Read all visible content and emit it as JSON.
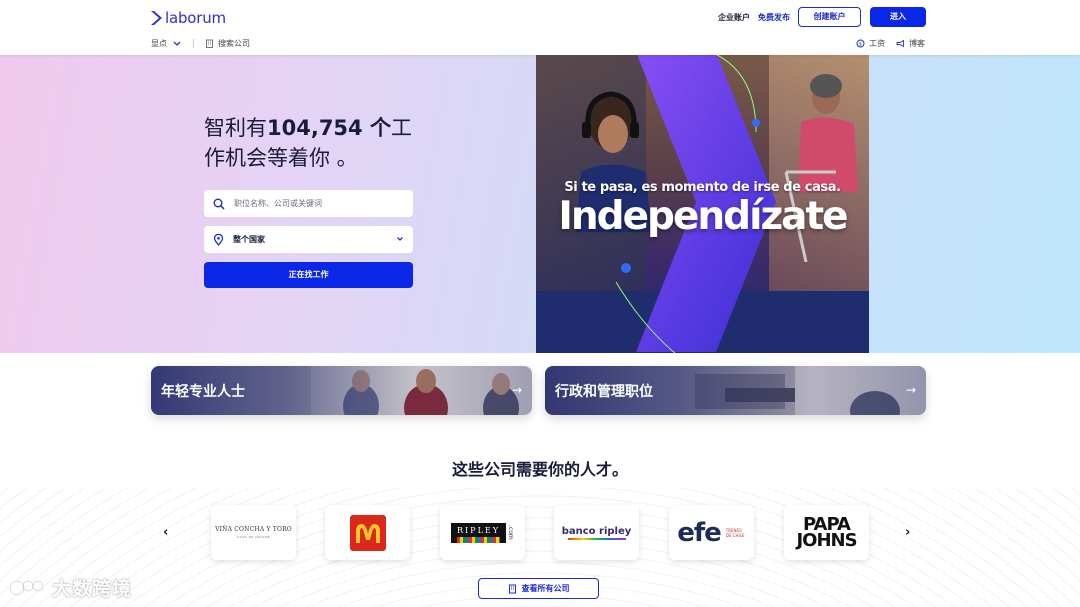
{
  "header": {
    "logo_text": "laborum",
    "enterprise_label": "企业账户",
    "free_post_label": "免费发布",
    "create_account_label": "创建账户",
    "login_label": "进入",
    "subnav_highlights": "显点",
    "subnav_search_companies": "搜索公司",
    "subnav_salary": "工资",
    "subnav_blog": "博客"
  },
  "hero": {
    "title_prefix": "智利有",
    "title_count": "104,754 个",
    "title_suffix": "工作机会等着你 。",
    "search_placeholder": "职位名称、公司或关键词",
    "location_value": "整个国家",
    "search_button": "正在找工作",
    "banner_subtitle": "Si te pasa, es momento de irse de casa.",
    "banner_title": "Independízate"
  },
  "categories": [
    {
      "label": "年轻专业人士"
    },
    {
      "label": "行政和管理职位"
    }
  ],
  "companies": {
    "title": "这些公司需要你的人才。",
    "logos": [
      {
        "line1": "VIÑA CONCHA Y TORO",
        "line2": "CASA DE ORIGEN"
      },
      {
        "mark": "M"
      },
      {
        "text": "RIPLEY",
        "suffix": ".com"
      },
      {
        "text": "banco ripley"
      },
      {
        "text": "efe",
        "side": "TRENES DE CHILE"
      },
      {
        "line1": "PAPA",
        "line2": "JOHNS"
      }
    ],
    "view_all_label": "查看所有公司"
  },
  "watermark": {
    "text": "大数跨境"
  },
  "colors": {
    "primary": "#0a26e6",
    "brand": "#2f2fc8",
    "text_dark": "#1b1c3a"
  }
}
